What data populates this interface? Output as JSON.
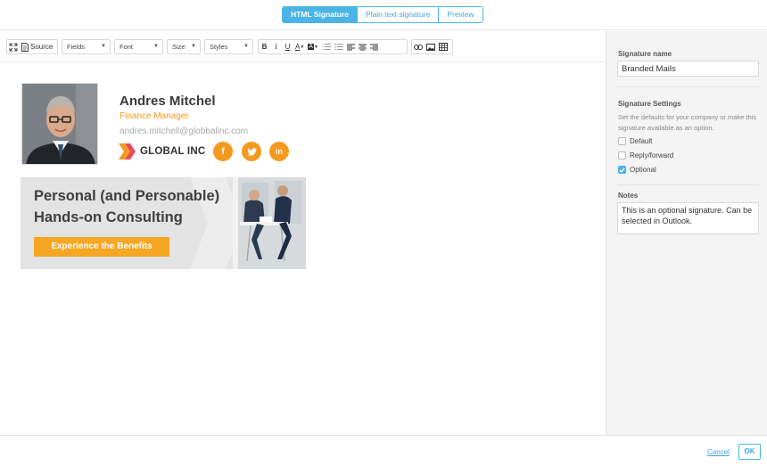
{
  "tabs": [
    {
      "label": "HTML Signature",
      "active": true
    },
    {
      "label": "Plain text signature",
      "active": false
    },
    {
      "label": "Preview",
      "active": false
    }
  ],
  "toolbar": {
    "source_label": "Source",
    "fields_label": "Fields",
    "font_label": "Font",
    "size_label": "Size",
    "styles_label": "Styles",
    "bold": "B",
    "italic": "I",
    "underline": "U",
    "text_color": "A",
    "bg_color": "A"
  },
  "signature": {
    "name": "Andres Mitchel",
    "title": "Finance Manager",
    "email": "andres.mitchell@globbalinc.com",
    "company": "GLOBAL INC",
    "social": [
      {
        "icon": "facebook-icon",
        "glyph": "f"
      },
      {
        "icon": "twitter-icon",
        "glyph": "t"
      },
      {
        "icon": "linkedin-icon",
        "glyph": "in"
      }
    ],
    "banner": {
      "line1": "Personal (and Personable)",
      "line2": "Hands-on Consulting",
      "button": "Experience the Benefits"
    }
  },
  "side": {
    "name_label": "Signature name",
    "name_value": "Branded Mails",
    "settings_label": "Signature Settings",
    "settings_desc": "Set the defaults for your company or make this signature available as an option.",
    "options": [
      {
        "label": "Default",
        "checked": false
      },
      {
        "label": "Reply/forward",
        "checked": false
      },
      {
        "label": "Optional",
        "checked": true
      }
    ],
    "notes_label": "Notes",
    "notes_value": "This is an optional signature. Can be selected in Outlook."
  },
  "footer": {
    "cancel": "Cancel",
    "ok": "OK"
  },
  "colors": {
    "accent": "#4ab4e6",
    "brand_orange": "#f39a1f"
  }
}
